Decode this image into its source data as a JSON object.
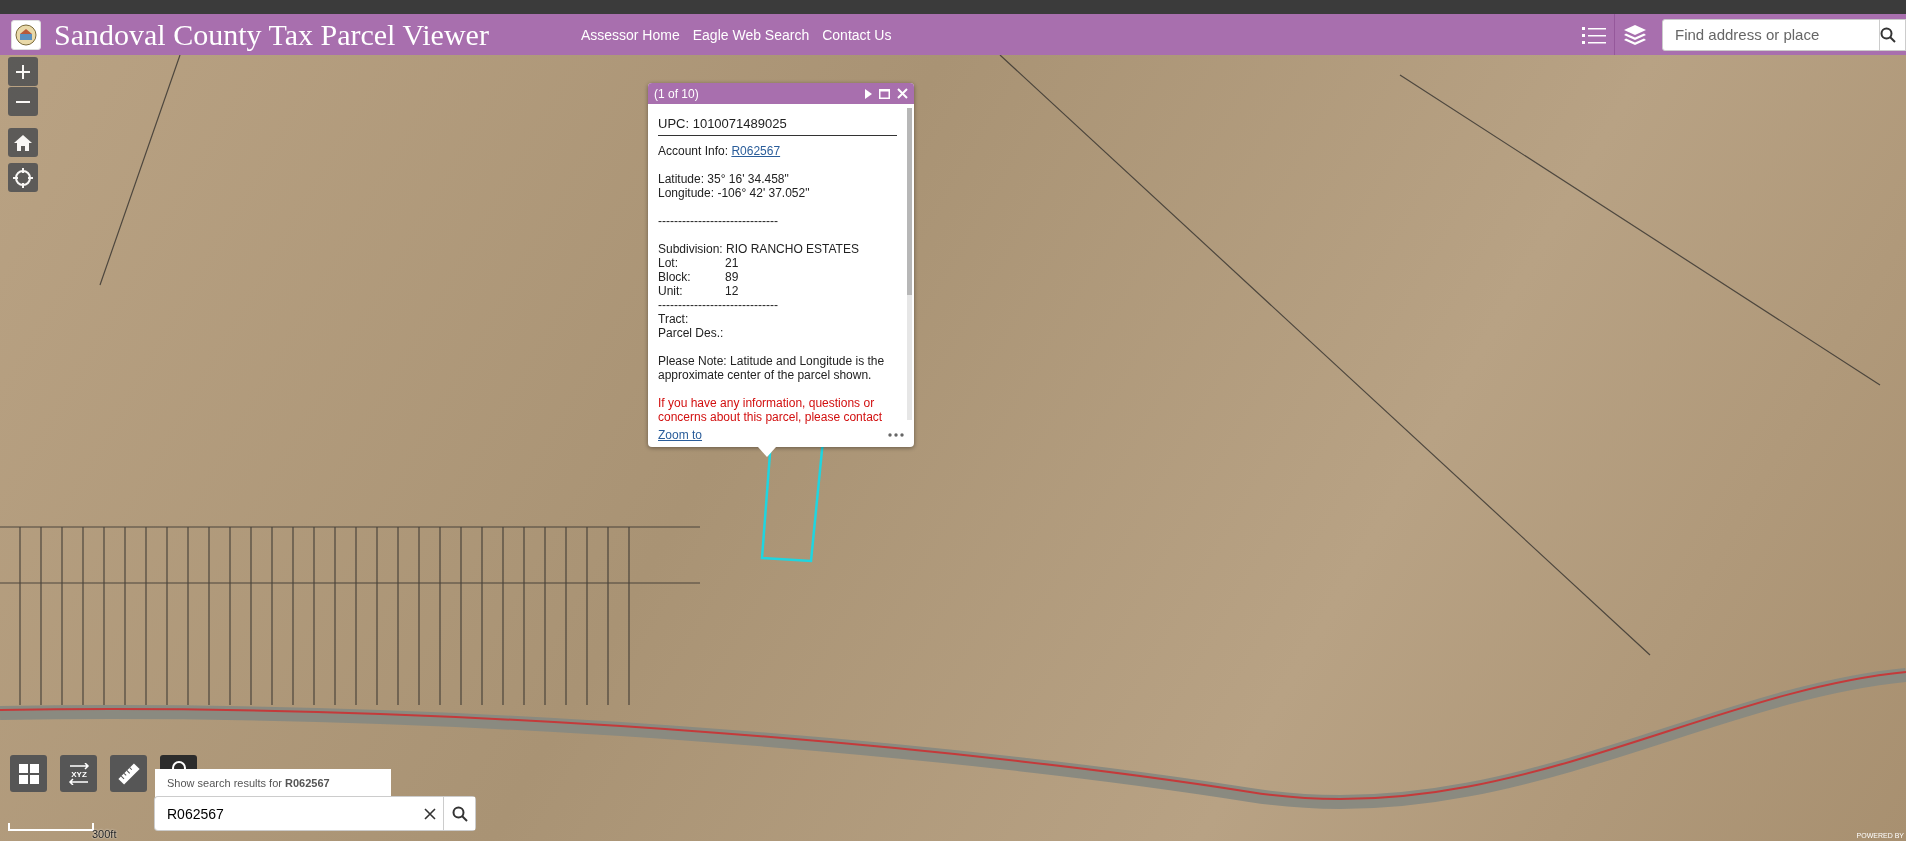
{
  "header": {
    "title": "Sandoval County Tax Parcel Viewer",
    "links": [
      "Assessor Home",
      "Eagle Web Search",
      "Contact Us"
    ],
    "search": {
      "placeholder": "Find address or place"
    }
  },
  "popup": {
    "pager": "(1 of 10)",
    "upc": "UPC: 1010071489025",
    "account_label": "Account Info:",
    "account_link": "R062567",
    "latitude": "Latitude: 35° 16' 34.458\"",
    "longitude": "Longitude: -106° 42' 37.052\"",
    "separator_1": "------------------------------",
    "subdivision": "Subdivision: RIO RANCHO ESTATES",
    "details": [
      {
        "label": "Lot:",
        "value": "21"
      },
      {
        "label": "Block:",
        "value": "89"
      },
      {
        "label": "Unit:",
        "value": "12"
      }
    ],
    "separator_2": "------------------------------",
    "tract": "Tract:",
    "parcel_des": "Parcel Des.:",
    "note": "Please Note: Latitude and Longitude is the approximate center of the parcel shown.",
    "warning": "If you have any information, questions or concerns about this parcel, please contact",
    "zoom_link": "Zoom to"
  },
  "coordinate_tool_label": "XYZ",
  "search": {
    "suggestion": "Show search results for **R062567**",
    "value": "R062567"
  },
  "scale": "300ft",
  "attribution": "POWERED BY"
}
